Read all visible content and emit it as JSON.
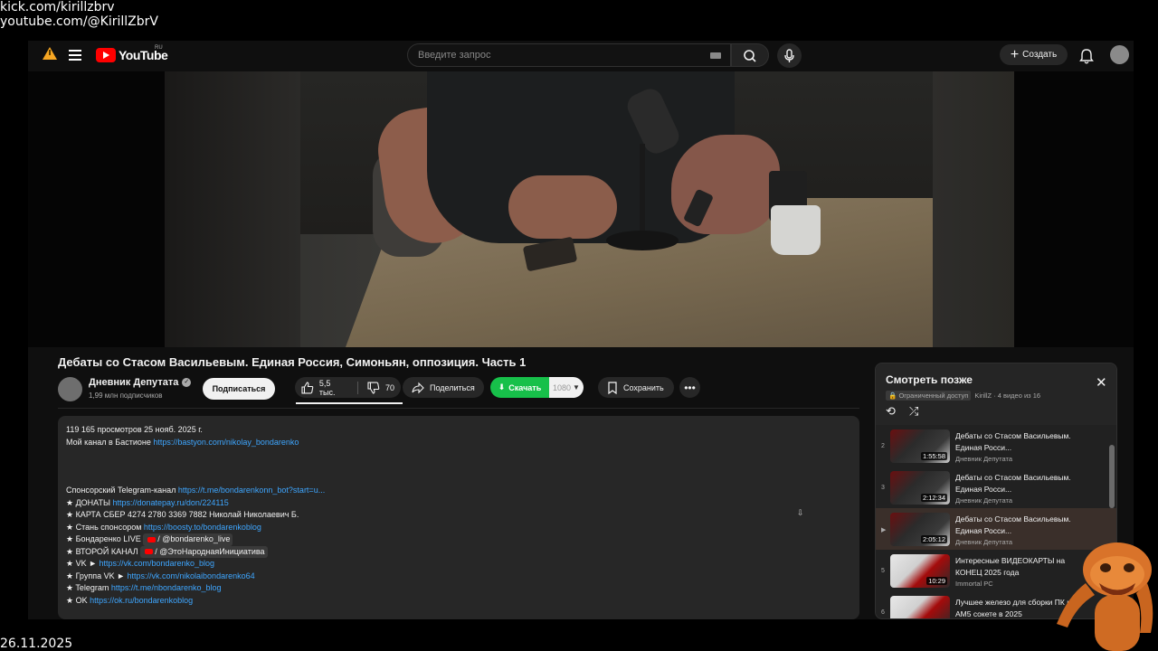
{
  "stream_overlay": {
    "line1": "kick.com/kirillzbrv",
    "line2": "youtube.com/@KirillZbrV",
    "date": "26.11.2025"
  },
  "header": {
    "logo_text": "YouTube",
    "region": "RU",
    "search_placeholder": "Введите запрос",
    "create_label": "Создать"
  },
  "video": {
    "title": "Дебаты со Стасом Васильевым. Единая Россия, Симоньян, оппозиция. Часть 1",
    "channel_name": "Дневник Депутата",
    "subscribers": "1,99 млн подписчиков",
    "subscribe_label": "Подписаться",
    "likes": "5,5 тыс.",
    "dislikes": "70",
    "share_label": "Поделиться",
    "download_label": "Скачать",
    "download_quality": "1080",
    "save_label": "Сохранить"
  },
  "description": {
    "stats": "119 165 просмотров  25 нояб. 2025 г.",
    "bastion_text": "Мой канал в Бастионе ",
    "bastion_link": "https://bastyon.com/nikolay_bondarenko",
    "tg_text": "Спонсорский Telegram-канал ",
    "tg_link": "https://t.me/bondarenkonn_bot?start=u...",
    "donate_text": "★ ДОНАТЫ ",
    "donate_link": "https://donatepay.ru/don/224115",
    "card_text": "★ КАРТА СБЕР 4274 2780 3369 7882 Николай Николаевич Б.",
    "boosty_text": "★ Стань спонсором ",
    "boosty_link": "https://boosty.to/bondarenkoblog",
    "live_text": "★ Бондаренко LIVE ",
    "live_tag": "/ @bondarenko_live",
    "second_text": "★ ВТОРОЙ КАНАЛ ",
    "second_tag": "/ @ЭтоНароднаяИнициатива",
    "vk_text": "★ VK ► ",
    "vk_link": "https://vk.com/bondarenko_blog",
    "vkgroup_text": "★ Группа VK ► ",
    "vkgroup_link": "https://vk.com/nikolaibondarenko64",
    "telegram_text": "★ Telegram ",
    "telegram_link": "https://t.me/nbondarenko_blog",
    "ok_text": "★ OK ",
    "ok_link": "https://ok.ru/bondarenkoblog"
  },
  "watch_later": {
    "title": "Смотреть позже",
    "access": "Ограниченный доступ",
    "meta": "KirillZ · 4 видео из 16",
    "items": [
      {
        "index": "2",
        "title": "Дебаты со Стасом Васильевым. Единая Росси...",
        "channel": "Дневник Депутата",
        "duration": "1:55:58"
      },
      {
        "index": "3",
        "title": "Дебаты со Стасом Васильевым. Единая Росси...",
        "channel": "Дневник Депутата",
        "duration": "2:12:34"
      },
      {
        "index": "▶",
        "title": "Дебаты со Стасом Васильевым. Единая Росси...",
        "channel": "Дневник Депутата",
        "duration": "2:05:12"
      },
      {
        "index": "5",
        "title": "Интересные ВИДЕОКАРТЫ на КОНЕЦ 2025 года",
        "channel": "Immortal PC",
        "duration": "10:29"
      },
      {
        "index": "6",
        "title": "Лучшее железо для сборки ПК на AM5 сокете в 2025",
        "channel": "",
        "duration": ""
      }
    ]
  }
}
